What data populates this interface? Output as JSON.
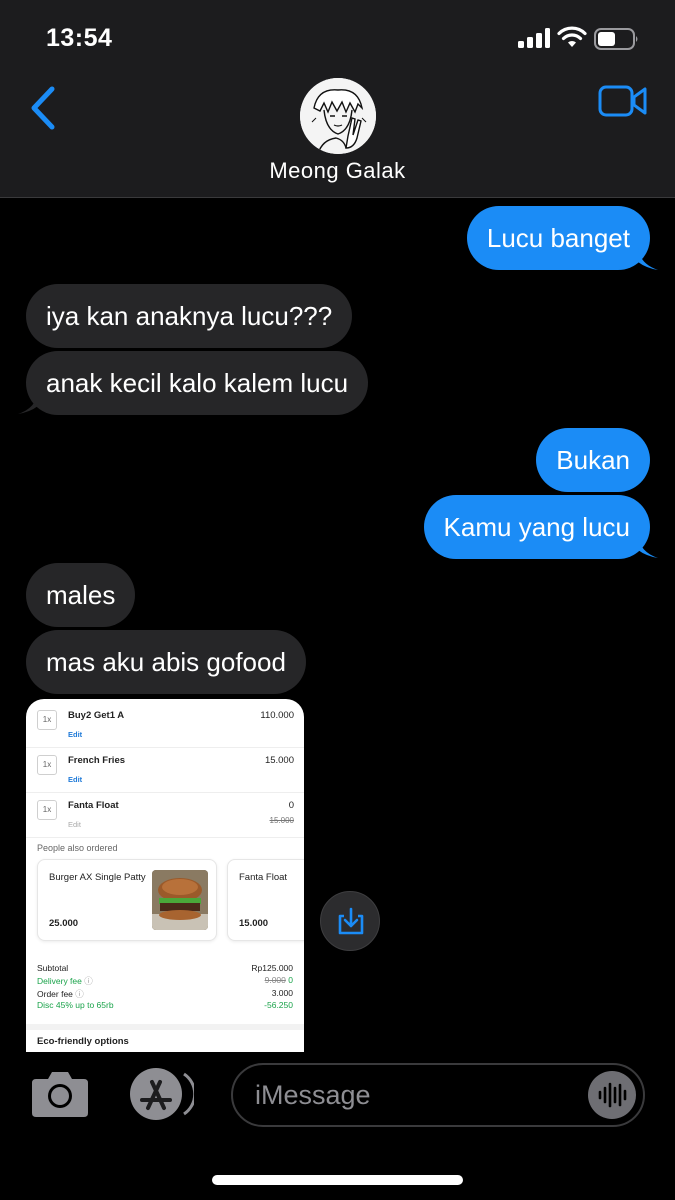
{
  "status_bar": {
    "time": "13:54"
  },
  "header": {
    "contact_name": "Meong Galak",
    "back_icon": "chevron-left-icon",
    "video_icon": "video-camera-icon",
    "accent_color": "#1b8cf6"
  },
  "messages": [
    {
      "direction": "outgoing",
      "text": "Lucu banget"
    },
    {
      "direction": "incoming",
      "text": "iya kan anaknya lucu???"
    },
    {
      "direction": "incoming",
      "text": "anak kecil kalo kalem lucu"
    },
    {
      "direction": "outgoing",
      "text": "Bukan"
    },
    {
      "direction": "outgoing",
      "text": "Kamu yang lucu"
    },
    {
      "direction": "incoming",
      "text": "males"
    },
    {
      "direction": "incoming",
      "text": "mas aku abis gofood"
    }
  ],
  "attachment": {
    "items": [
      {
        "qty": "1x",
        "name": "Buy2 Get1 A",
        "edit": "Edit",
        "price": "110.000"
      },
      {
        "qty": "1x",
        "name": "French Fries",
        "edit": "Edit",
        "price": "15.000"
      },
      {
        "qty": "1x",
        "name": "Fanta Float",
        "edit": "Edit",
        "price": "0",
        "old_price": "15.000"
      }
    ],
    "people_also_ordered": "People also ordered",
    "suggestions": [
      {
        "name": "Burger AX Single Patty",
        "price": "25.000"
      },
      {
        "name": "Fanta Float",
        "price": "15.000"
      }
    ],
    "summary": {
      "subtotal_label": "Subtotal",
      "subtotal_value": "Rp125.000",
      "delivery_label": "Delivery fee",
      "delivery_old": "9.000",
      "delivery_value": "0",
      "order_fee_label": "Order fee",
      "order_fee_value": "3.000",
      "discount_label": "Disc 45% up to 65rb",
      "discount_value": "-56.250"
    },
    "eco_label": "Eco-friendly options"
  },
  "input_bar": {
    "placeholder": "iMessage",
    "camera_icon": "camera-icon",
    "apps_icon": "app-store-icon",
    "audio_icon": "audio-waveform-icon"
  }
}
